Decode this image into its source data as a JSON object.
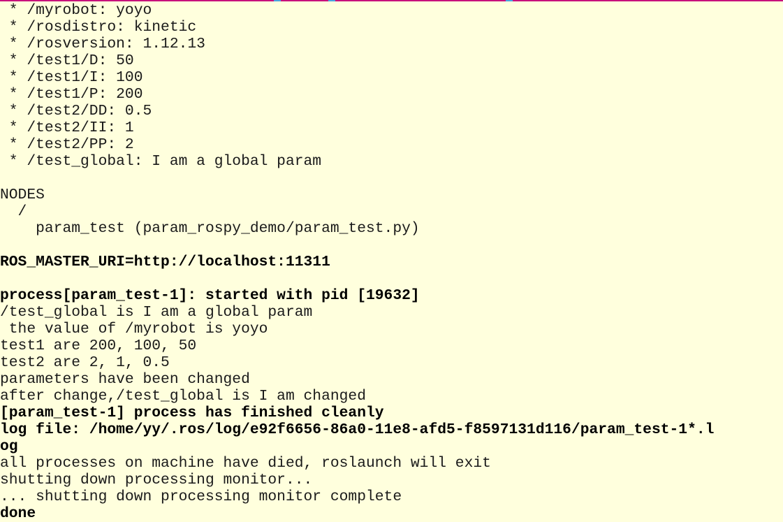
{
  "terminal": {
    "background": "#ffffdd",
    "top_border_color": "#c8107c",
    "lines": [
      {
        "text": " * /myrobot: yoyo",
        "bold": false
      },
      {
        "text": " * /rosdistro: kinetic",
        "bold": false
      },
      {
        "text": " * /rosversion: 1.12.13",
        "bold": false
      },
      {
        "text": " * /test1/D: 50",
        "bold": false
      },
      {
        "text": " * /test1/I: 100",
        "bold": false
      },
      {
        "text": " * /test1/P: 200",
        "bold": false
      },
      {
        "text": " * /test2/DD: 0.5",
        "bold": false
      },
      {
        "text": " * /test2/II: 1",
        "bold": false
      },
      {
        "text": " * /test2/PP: 2",
        "bold": false
      },
      {
        "text": " * /test_global: I am a global param",
        "bold": false
      },
      {
        "text": "",
        "bold": false
      },
      {
        "text": "NODES",
        "bold": false
      },
      {
        "text": "  /",
        "bold": false
      },
      {
        "text": "    param_test (param_rospy_demo/param_test.py)",
        "bold": false
      },
      {
        "text": "",
        "bold": false
      },
      {
        "text": "ROS_MASTER_URI=http://localhost:11311",
        "bold": true
      },
      {
        "text": "",
        "bold": false
      },
      {
        "text": "process[param_test-1]: started with pid [19632]",
        "bold": true
      },
      {
        "text": "/test_global is I am a global param",
        "bold": false
      },
      {
        "text": " the value of /myrobot is yoyo",
        "bold": false
      },
      {
        "text": "test1 are 200, 100, 50",
        "bold": false
      },
      {
        "text": "test2 are 2, 1, 0.5",
        "bold": false
      },
      {
        "text": "parameters have been changed",
        "bold": false
      },
      {
        "text": "after change,/test_global is I am changed",
        "bold": false
      },
      {
        "text": "[param_test-1] process has finished cleanly",
        "bold": true
      },
      {
        "text": "log file: /home/yy/.ros/log/e92f6656-86a0-11e8-afd5-f8597131d116/param_test-1*.l",
        "bold": true
      },
      {
        "text": "og",
        "bold": true
      },
      {
        "text": "all processes on machine have died, roslaunch will exit",
        "bold": false
      },
      {
        "text": "shutting down processing monitor...",
        "bold": false
      },
      {
        "text": "... shutting down processing monitor complete",
        "bold": false
      },
      {
        "text": "done",
        "bold": true
      }
    ]
  }
}
